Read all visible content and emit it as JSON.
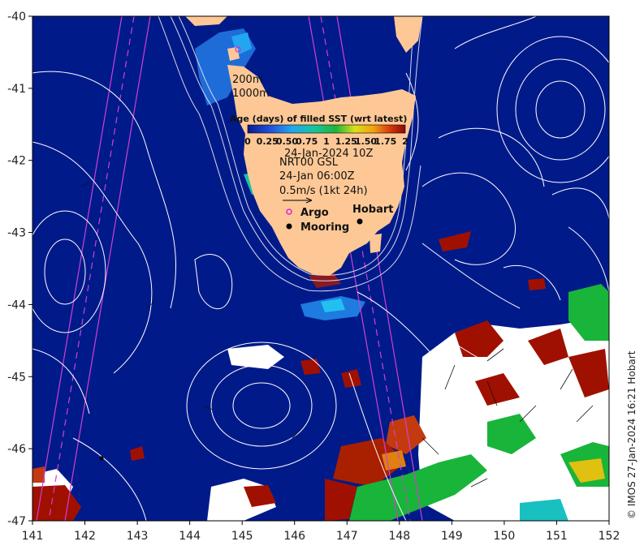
{
  "map": {
    "x_ticks": [
      "141",
      "142",
      "143",
      "144",
      "145",
      "146",
      "147",
      "148",
      "149",
      "150",
      "151",
      "152"
    ],
    "y_ticks": [
      "-40",
      "-41",
      "-42",
      "-43",
      "-44",
      "-45",
      "-46",
      "-47"
    ],
    "lon_range": [
      141,
      152
    ],
    "lat_range": [
      -47,
      -40
    ]
  },
  "colors": {
    "ocean": "#001a8a",
    "land": "#fdc896",
    "cloud": "#ffffff",
    "track": "#d040d0",
    "contour": "#ffffff",
    "recent_blue": "#1e7be0",
    "old_red": "#a01000",
    "green": "#19b43a"
  },
  "labels": {
    "isobath_200": "200m",
    "isobath_1000": "1000m",
    "colorbar_title": "Age (days) of filled SST (wrt latest)",
    "colorbar_ticks": [
      "0",
      "0.25",
      "0.50",
      "0.75",
      "1",
      "1.25",
      "1.50",
      "1.75",
      "2"
    ],
    "sst_date": "24-Jan-2024 10Z",
    "altimetry": "NRT00 GSL",
    "altimetry_time": "24-Jan 06:00Z",
    "vector_scale": "0.5m/s (1kt 24h)",
    "argo": "Argo",
    "mooring": "Mooring",
    "city": "Hobart",
    "credit": "© IMOS 27-Jan-2024 16:21 Hobart"
  }
}
